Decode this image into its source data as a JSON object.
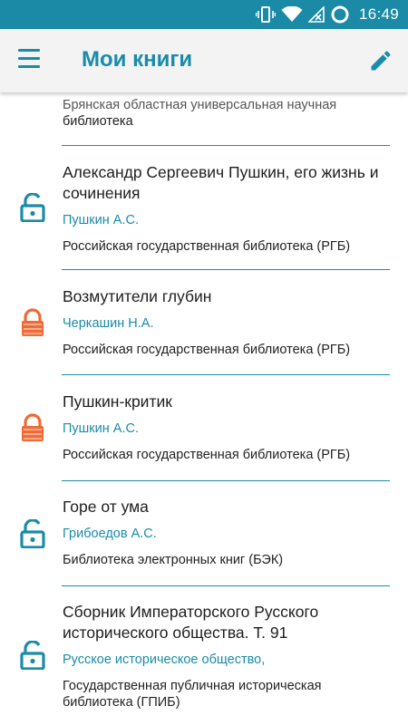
{
  "status_bar": {
    "time": "16:49",
    "icons": [
      "vibrate-icon",
      "wifi-icon",
      "no-sim-icon",
      "battery-icon"
    ]
  },
  "app_bar": {
    "title": "Мои книги",
    "menu_icon": "menu-icon",
    "edit_icon": "edit-pencil-icon"
  },
  "colors": {
    "accent": "#1a8ba8",
    "status_bar": "#1b8aa6",
    "lock_open": "#1a8ba8",
    "lock_closed": "#f06a35"
  },
  "partial_item": {
    "library_line1": "Брянская областная универсальная научная",
    "library_line2": "библиотека"
  },
  "books": [
    {
      "title": "Александр Сергеевич Пушкин, его жизнь и сочинения",
      "author": "Пушкин А.С.",
      "library": "Российская государственная библиотека (РГБ)",
      "lock": "open"
    },
    {
      "title": "Возмутители глубин",
      "author": "Черкашин Н.А.",
      "library": "Российская государственная библиотека (РГБ)",
      "lock": "closed"
    },
    {
      "title": "Пушкин-критик",
      "author": "Пушкин А.С.",
      "library": "Российская государственная библиотека (РГБ)",
      "lock": "closed"
    },
    {
      "title": "Горе от ума",
      "author": "Грибоедов А.С.",
      "library": "Библиотека электронных книг (БЭК)",
      "lock": "open"
    },
    {
      "title": "Сборник Императорского Русского исторического общества. Т. 91",
      "author": "Русское историческое общество,",
      "library": "Государственная публичная историческая библиотека (ГПИБ)",
      "lock": "open"
    }
  ]
}
